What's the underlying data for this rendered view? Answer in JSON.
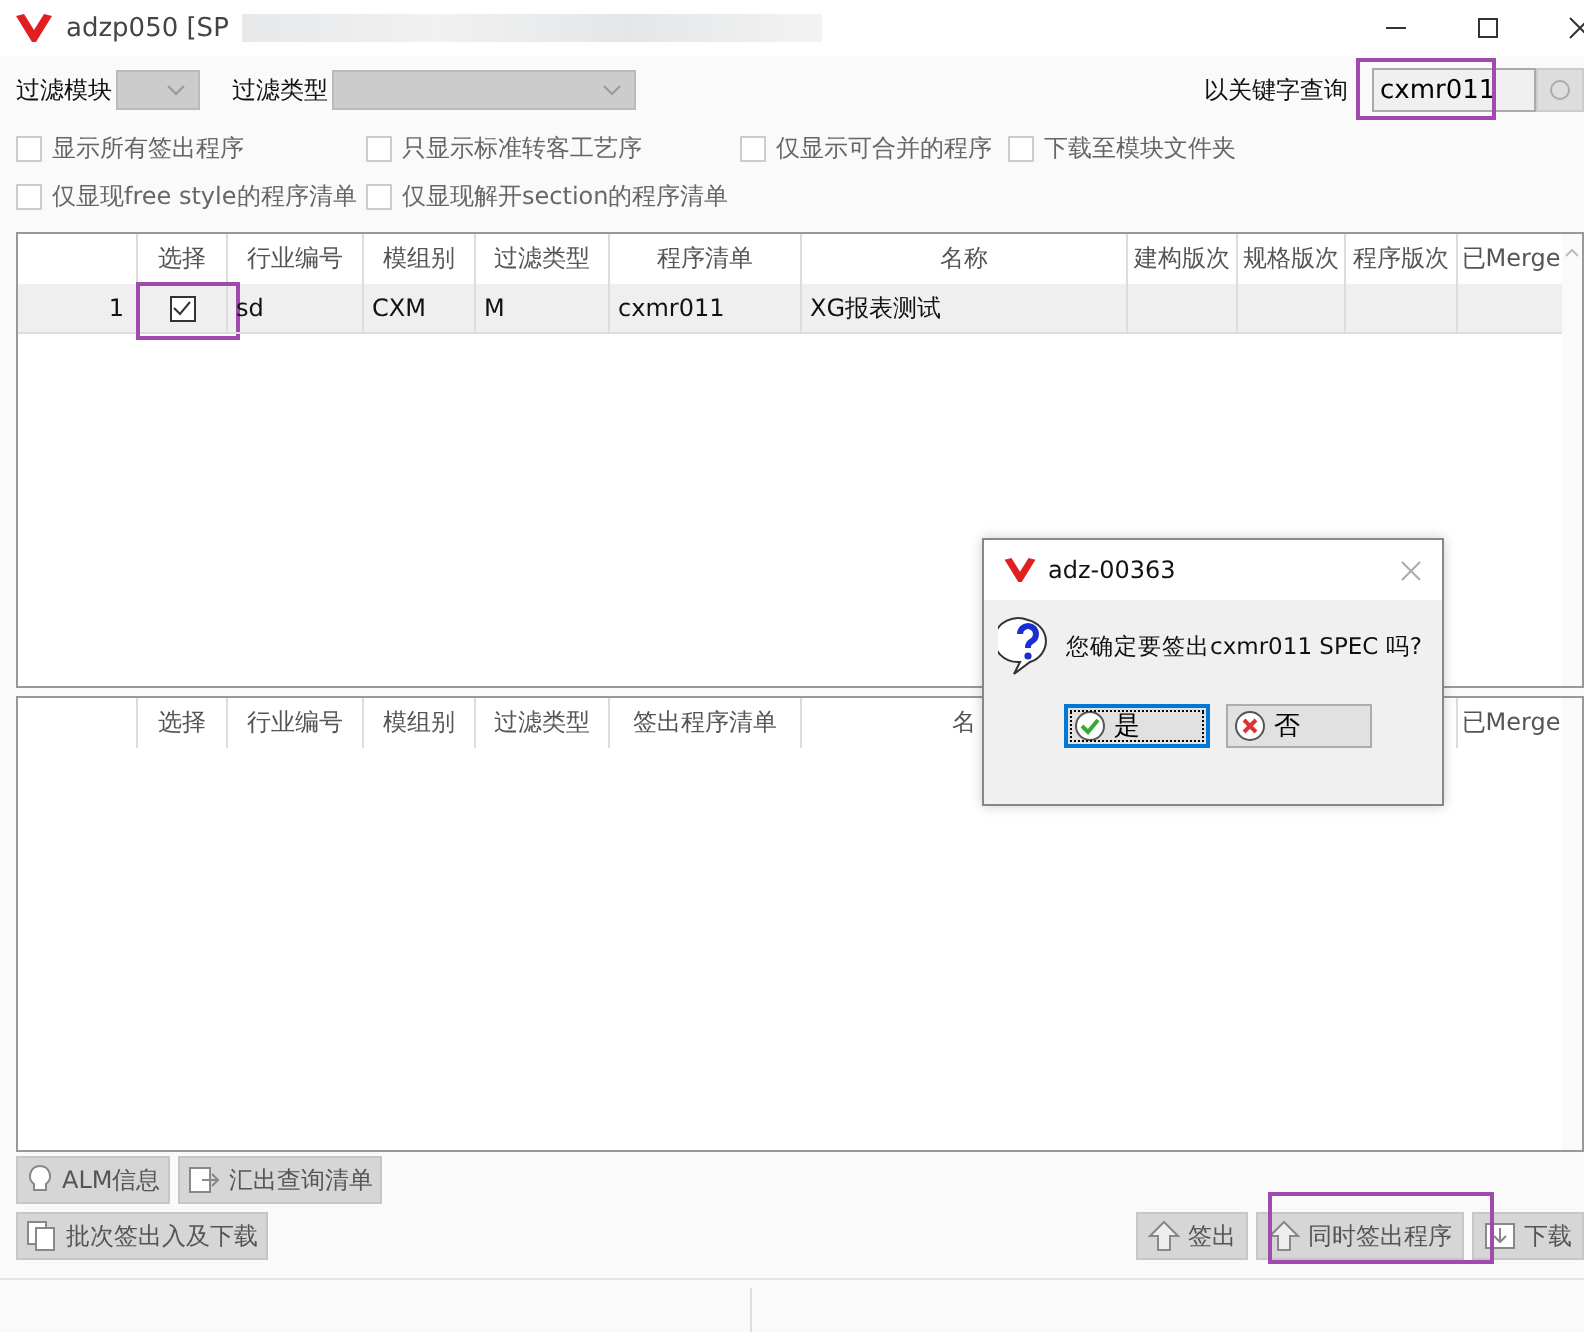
{
  "window": {
    "title": "adzp050 [SP"
  },
  "filters": [
    {
      "label": "过滤模块"
    },
    {
      "label": "过滤类型"
    }
  ],
  "search": {
    "label": "以关键字查询",
    "value": "cxmr011"
  },
  "options": [
    [
      {
        "label": "显示所有签出程序",
        "checked": false,
        "disabled": true
      },
      {
        "label": "只显示标准转客工艺序",
        "checked": false,
        "disabled": true
      },
      {
        "label": "仅显示可合并的程序",
        "checked": false,
        "disabled": true
      },
      {
        "label": "下载至模块文件夹",
        "checked": false,
        "disabled": true
      }
    ],
    [
      {
        "label": "仅显现free style的程序清单",
        "checked": false,
        "disabled": true
      },
      {
        "label": "仅显现解开section的程序清单",
        "checked": false,
        "disabled": true
      }
    ]
  ],
  "upper_grid": {
    "columns": [
      "选择",
      "行业编号",
      "模组别",
      "过滤类型",
      "程序清单",
      "名称",
      "建构版次",
      "规格版次",
      "程序版次",
      "已Merge"
    ],
    "rows": [
      {
        "row_number": "1",
        "checked": true,
        "selected": true,
        "cells": [
          "",
          "sd",
          "CXM",
          "M",
          "cxmr011",
          "XG报表测试"
        ]
      }
    ]
  },
  "lower_grid": {
    "columns": [
      {
        "label": "选择"
      },
      {
        "label": "行业编号"
      },
      {
        "label": "模组别"
      },
      {
        "label": "过滤类型"
      },
      {
        "label": "签出程序清单"
      },
      {
        "label": "名"
      },
      {},
      {},
      {},
      {
        "label": "已Merge"
      }
    ]
  },
  "left_buttons": [
    [
      {
        "label": "ALM信息",
        "kind": "bulb"
      },
      {
        "label": "汇出查询清单",
        "kind": "export"
      }
    ],
    [
      {
        "label": "批次签出入及下载",
        "kind": "batch"
      }
    ]
  ],
  "right_buttons": [
    {
      "label": "签出",
      "kind": "up"
    },
    {
      "label": "同时签出程序",
      "kind": "up"
    },
    {
      "label": "下载",
      "kind": "download"
    }
  ],
  "dialog": {
    "title": "adz-00363",
    "message": "您确定要签出cxmr011 SPEC 吗?",
    "buttons": [
      {
        "label": "是",
        "kind": "yes",
        "selected": true
      },
      {
        "label": "否",
        "kind": "no",
        "selected": false
      }
    ]
  }
}
